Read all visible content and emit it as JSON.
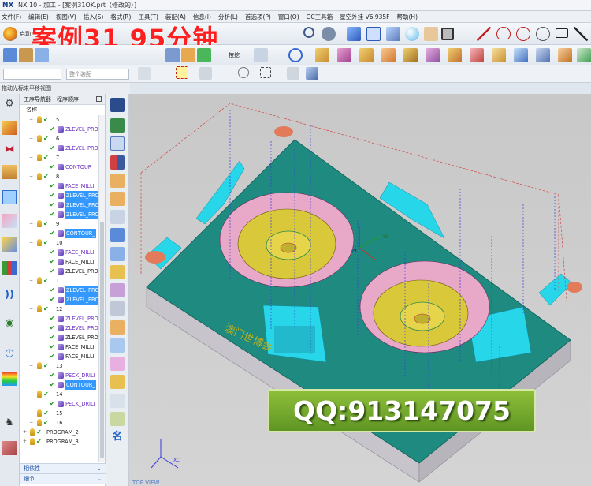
{
  "window": {
    "logo": "NX",
    "title": "NX 10 - 加工 - [案例31OK.prt（修改的）]"
  },
  "menu": [
    "文件(F)",
    "编辑(E)",
    "视图(V)",
    "插入(S)",
    "格式(R)",
    "工具(T)",
    "装配(A)",
    "信息(I)",
    "分析(L)",
    "首选项(P)",
    "窗口(O)",
    "GC工具箱",
    "星空外挂 V6.935F",
    "帮助(H)"
  ],
  "overlay_title": "案例31  95分钟",
  "toolbar": {
    "start_label": "启动",
    "fragment_label": "按挖",
    "filter_placeholder": "",
    "assembly_select": "整个装配"
  },
  "drag_hint": "拖动光标来平移视图",
  "navigator": {
    "title": "工序导航器 - 程序顺序",
    "column_name": "名称",
    "rows": [
      {
        "label": "5",
        "kind": "group"
      },
      {
        "label": "ZLEVEL_PRO",
        "kind": "op"
      },
      {
        "label": "6",
        "kind": "group"
      },
      {
        "label": "ZLEVEL_PRO",
        "kind": "op"
      },
      {
        "label": "7",
        "kind": "group"
      },
      {
        "label": "CONTOUR_",
        "kind": "op"
      },
      {
        "label": "8",
        "kind": "group"
      },
      {
        "label": "FACE_MILLI",
        "kind": "op"
      },
      {
        "label": "ZLEVEL_PRO",
        "kind": "sel"
      },
      {
        "label": "ZLEVEL_PRO",
        "kind": "sel"
      },
      {
        "label": "ZLEVEL_PRO",
        "kind": "sel"
      },
      {
        "label": "9",
        "kind": "group"
      },
      {
        "label": "CONTOUR_",
        "kind": "sel"
      },
      {
        "label": "10",
        "kind": "group"
      },
      {
        "label": "FACE_MILLI",
        "kind": "op"
      },
      {
        "label": "FACE_MILLI",
        "kind": "plain"
      },
      {
        "label": "ZLEVEL_PRO",
        "kind": "plain"
      },
      {
        "label": "11",
        "kind": "group"
      },
      {
        "label": "ZLEVEL_PRO",
        "kind": "sel"
      },
      {
        "label": "ZLEVEL_PRO",
        "kind": "sel"
      },
      {
        "label": "12",
        "kind": "group"
      },
      {
        "label": "ZLEVEL_PRO",
        "kind": "op"
      },
      {
        "label": "ZLEVEL_PRO",
        "kind": "op"
      },
      {
        "label": "ZLEVEL_PRO",
        "kind": "plain"
      },
      {
        "label": "FACE_MILLI",
        "kind": "plain"
      },
      {
        "label": "FACE_MILLI",
        "kind": "plain"
      },
      {
        "label": "13",
        "kind": "group"
      },
      {
        "label": "PECK_DRILI",
        "kind": "op"
      },
      {
        "label": "CONTOUR_",
        "kind": "sel"
      },
      {
        "label": "14",
        "kind": "group"
      },
      {
        "label": "PECK_DRILI",
        "kind": "op"
      },
      {
        "label": "15",
        "kind": "group"
      },
      {
        "label": "16",
        "kind": "group"
      },
      {
        "label": "PROGRAM_2",
        "kind": "program"
      },
      {
        "label": "PROGRAM_3",
        "kind": "program"
      }
    ],
    "footer": [
      "相依性",
      "细节"
    ]
  },
  "viewport": {
    "axis_label_zc": "ZC",
    "axis_label_yc": "YC",
    "axis_label_xc": "XC",
    "view_label": "TOP VIEW",
    "tilt_text": "澳门世博会"
  },
  "watermark": "QQ:913147075",
  "colors": {
    "part_top": "#1e8a80",
    "cyan_wall": "#27d6e8",
    "pink_bowl": "#e8a8c8",
    "yellow_floor": "#d8c83a",
    "side_wall": "#c8c4cc",
    "path_blue": "#3a3ae0",
    "path_red": "#d23030",
    "title_red": "#ff1f1f"
  }
}
